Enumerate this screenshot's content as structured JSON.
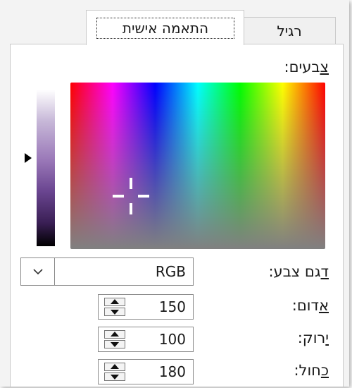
{
  "tabs": {
    "regular_label": "רגיל",
    "custom_label": "התאמה אישית"
  },
  "colors_label": {
    "underlined": "צ",
    "rest": "בעים:"
  },
  "model": {
    "label_underlined": "ד",
    "label_rest": "גם צבע:",
    "value": "RGB"
  },
  "red": {
    "label_underlined": "א",
    "label_rest": "דום:",
    "value": "150"
  },
  "green": {
    "label_underlined": "י",
    "label_rest": "רוק:",
    "value": "100"
  },
  "blue": {
    "label_underlined": "כ",
    "label_rest": "חול:",
    "value": "180"
  },
  "colors": {
    "selected": "#9664b4",
    "tab_border": "#c9c9c9",
    "field_border": "#8a8a8a"
  }
}
